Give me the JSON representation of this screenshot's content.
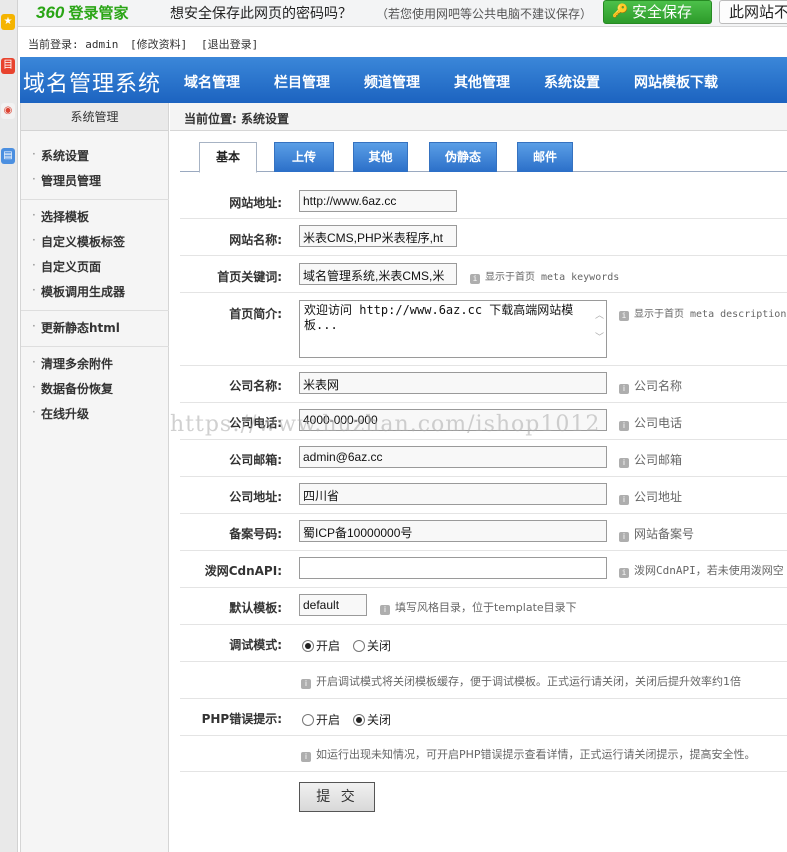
{
  "browser_bar": {
    "logo_num": "360",
    "logo_text": "登录管家",
    "question": "想安全保存此网页的密码吗？",
    "note": "（若您使用网吧等公共电脑不建议保存）",
    "save_label": "安全保存",
    "no_save_label": "此网站不"
  },
  "login": {
    "current": "当前登录: admin",
    "edit": "[修改资料]",
    "logout": "[退出登录]"
  },
  "header": {
    "brand": "域名管理系统",
    "nav": [
      "域名管理",
      "栏目管理",
      "频道管理",
      "其他管理",
      "系统设置",
      "网站模板下载"
    ]
  },
  "sidebar": {
    "title": "系统管理",
    "groups": [
      [
        "系统设置",
        "管理员管理"
      ],
      [
        "选择模板",
        "自定义模板标签",
        "自定义页面",
        "模板调用生成器"
      ],
      [
        "更新静态html"
      ],
      [
        "清理多余附件",
        "数据备份恢复",
        "在线升级"
      ]
    ]
  },
  "breadcrumb": "当前位置: 系统设置",
  "tabs": [
    "基本",
    "上传",
    "其他",
    "伪静态",
    "邮件"
  ],
  "form": {
    "site_url": {
      "label": "网站地址:",
      "value": "http://www.6az.cc"
    },
    "site_name": {
      "label": "网站名称:",
      "value": "米表CMS,PHP米表程序,ht"
    },
    "keywords": {
      "label": "首页关键词:",
      "value": "域名管理系统,米表CMS,米",
      "hint": "显示于首页 meta keywords"
    },
    "description": {
      "label": "首页简介:",
      "value": "欢迎访问 http://www.6az.cc 下载高端网站模板...",
      "hint": "显示于首页 meta description"
    },
    "company": {
      "label": "公司名称:",
      "value": "米表网",
      "hint": "公司名称"
    },
    "phone": {
      "label": "公司电话:",
      "value": "4000-000-000",
      "hint": "公司电话"
    },
    "email": {
      "label": "公司邮箱:",
      "value": "admin@6az.cc",
      "hint": "公司邮箱"
    },
    "address": {
      "label": "公司地址:",
      "value": "四川省",
      "hint": "公司地址"
    },
    "icp": {
      "label": "备案号码:",
      "value": "蜀ICP备10000000号",
      "hint": "网站备案号"
    },
    "cdn": {
      "label": "泼网CdnAPI:",
      "value": "",
      "hint": "泼网CdnAPI，若未使用泼网空"
    },
    "template": {
      "label": "默认模板:",
      "value": "default",
      "hint": "填写风格目录，位于template目录下"
    },
    "debug": {
      "label": "调试模式:",
      "on": "开启",
      "off": "关闭",
      "hint": "开启调试模式将关闭模板缓存，便于调试模板。正式运行请关闭，关闭后提升效率约1倍"
    },
    "php_error": {
      "label": "PHP错误提示:",
      "on": "开启",
      "off": "关闭",
      "hint": "如运行出现未知情况，可开启PHP错误提示查看详情，正式运行请关闭提示，提高安全性。"
    },
    "submit": "提 交"
  },
  "watermark": "https://www.huzhan.com/ishop1012"
}
